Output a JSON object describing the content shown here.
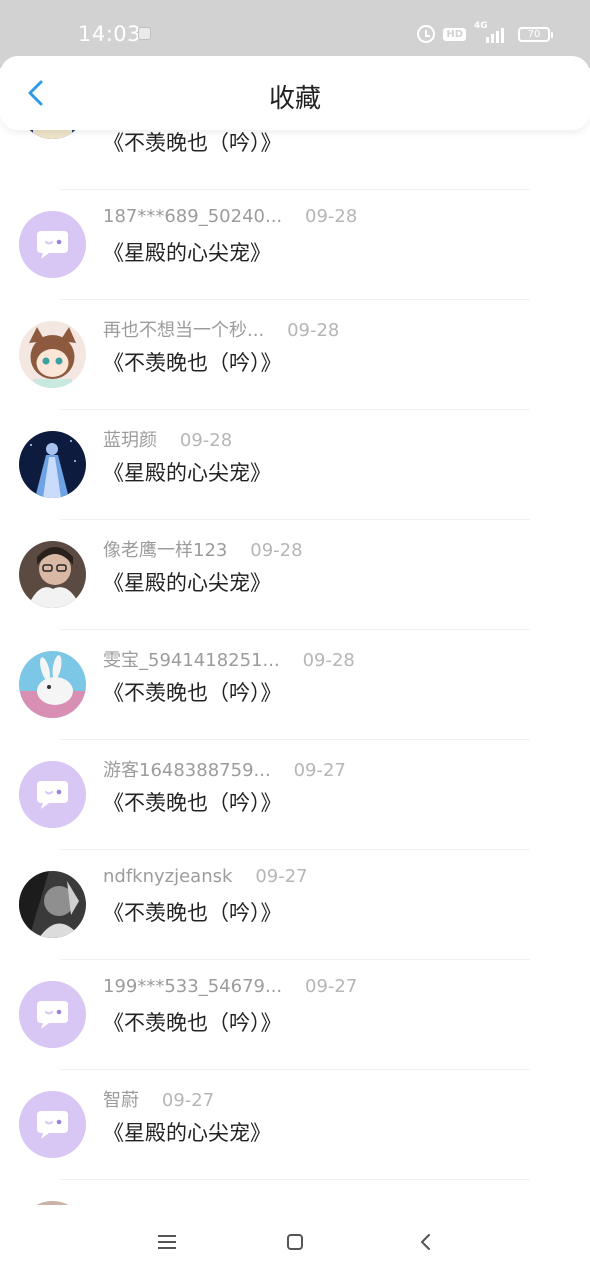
{
  "status_bar": {
    "time": "14:03",
    "hd_label": "HD",
    "network_label": "4G",
    "battery": "70"
  },
  "header": {
    "back_icon": "chevron-left-icon",
    "title": "收藏",
    "accent_color": "#2f9ae8"
  },
  "favorites": [
    {
      "name": "",
      "date": "",
      "book": "《不羡晚也（吟）》",
      "avatar": "cartoon-bear"
    },
    {
      "name": "187***689_50240...",
      "date": "09-28",
      "book": "《星殿的心尖宠》",
      "avatar": "default"
    },
    {
      "name": "再也不想当一个秒...",
      "date": "09-28",
      "book": "《不羡晚也（吟）》",
      "avatar": "anime-fox-girl"
    },
    {
      "name": "蓝玥颜",
      "date": "09-28",
      "book": "《星殿的心尖宠》",
      "avatar": "night-gown-girl"
    },
    {
      "name": "像老鹰一样123",
      "date": "09-28",
      "book": "《星殿的心尖宠》",
      "avatar": "photo-portrait"
    },
    {
      "name": "雯宝_5941418251...",
      "date": "09-28",
      "book": "《不羡晚也（吟）》",
      "avatar": "rabbit"
    },
    {
      "name": "游客1648388759...",
      "date": "09-27",
      "book": "《不羡晚也（吟）》",
      "avatar": "default"
    },
    {
      "name": "ndfknyzjeansk",
      "date": "09-27",
      "book": "《不羡晚也（吟）》",
      "avatar": "bw-portrait"
    },
    {
      "name": "199***533_54679...",
      "date": "09-27",
      "book": "《不羡晚也（吟）》",
      "avatar": "default"
    },
    {
      "name": "智蔚",
      "date": "09-27",
      "book": "《星殿的心尖宠》",
      "avatar": "default"
    }
  ],
  "nav_bar": {
    "menu_icon": "menu-icon",
    "home_icon": "home-square-icon",
    "back_icon": "back-triangle-icon"
  }
}
